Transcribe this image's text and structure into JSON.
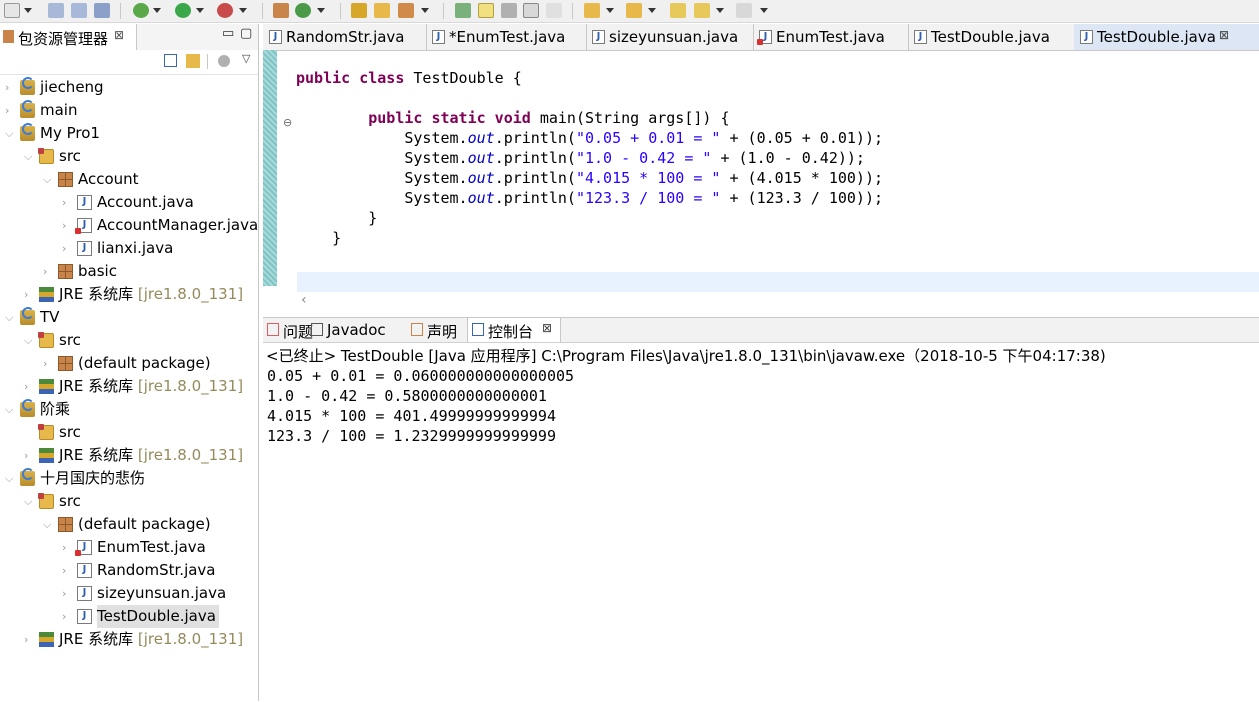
{
  "package_explorer": {
    "tab_title": "包资源管理器",
    "tree": [
      {
        "label": "jiecheng",
        "type": "project",
        "depth": 0,
        "expanded": false
      },
      {
        "label": "main",
        "type": "project",
        "depth": 0,
        "expanded": false
      },
      {
        "label": "My Pro1",
        "type": "project",
        "depth": 0,
        "expanded": true
      },
      {
        "label": "src",
        "type": "src",
        "depth": 1,
        "expanded": true
      },
      {
        "label": "Account",
        "type": "package",
        "depth": 2,
        "expanded": true
      },
      {
        "label": "Account.java",
        "type": "java",
        "depth": 3,
        "expanded": false
      },
      {
        "label": "AccountManager.java",
        "type": "java-err",
        "depth": 3,
        "expanded": false
      },
      {
        "label": "lianxi.java",
        "type": "java",
        "depth": 3,
        "expanded": false
      },
      {
        "label": "basic",
        "type": "package",
        "depth": 2,
        "expanded": false
      },
      {
        "label": "JRE 系统库",
        "suffix": "[jre1.8.0_131]",
        "type": "jre",
        "depth": 1,
        "expanded": false
      },
      {
        "label": "TV",
        "type": "project",
        "depth": 0,
        "expanded": true
      },
      {
        "label": "src",
        "type": "src",
        "depth": 1,
        "expanded": true
      },
      {
        "label": "(default package)",
        "type": "package",
        "depth": 2,
        "expanded": false
      },
      {
        "label": "JRE 系统库",
        "suffix": "[jre1.8.0_131]",
        "type": "jre",
        "depth": 1,
        "expanded": false
      },
      {
        "label": "阶乘",
        "type": "project",
        "depth": 0,
        "expanded": true
      },
      {
        "label": "src",
        "type": "src",
        "depth": 1,
        "expanded": false,
        "noTwistie": true
      },
      {
        "label": "JRE 系统库",
        "suffix": "[jre1.8.0_131]",
        "type": "jre",
        "depth": 1,
        "expanded": false
      },
      {
        "label": "十月国庆的悲伤",
        "type": "project",
        "depth": 0,
        "expanded": true
      },
      {
        "label": "src",
        "type": "src",
        "depth": 1,
        "expanded": true
      },
      {
        "label": "(default package)",
        "type": "package",
        "depth": 2,
        "expanded": true
      },
      {
        "label": "EnumTest.java",
        "type": "java-err",
        "depth": 3,
        "expanded": false
      },
      {
        "label": "RandomStr.java",
        "type": "java",
        "depth": 3,
        "expanded": false
      },
      {
        "label": "sizeyunsuan.java",
        "type": "java",
        "depth": 3,
        "expanded": false
      },
      {
        "label": "TestDouble.java",
        "type": "java",
        "depth": 3,
        "expanded": false,
        "selected": true
      },
      {
        "label": "JRE 系统库",
        "suffix": "[jre1.8.0_131]",
        "type": "jre",
        "depth": 1,
        "expanded": false
      }
    ]
  },
  "editor": {
    "tabs": [
      {
        "label": "RandomStr.java",
        "error": false,
        "active": false
      },
      {
        "label": "*EnumTest.java",
        "error": false,
        "active": false
      },
      {
        "label": "sizeyunsuan.java",
        "error": false,
        "active": false
      },
      {
        "label": "EnumTest.java",
        "error": true,
        "active": false
      },
      {
        "label": "TestDouble.java",
        "error": false,
        "active": false
      },
      {
        "label": "TestDouble.java",
        "error": false,
        "active": true
      }
    ],
    "code": {
      "class_kw": "public class",
      "class_name": " TestDouble {",
      "method_kw": "public static void",
      "method_sig": " main(String args[]) {",
      "lines": [
        {
          "pre": "System.",
          "fld": "out",
          "mid": ".println(",
          "str": "\"0.05 + 0.01 = \"",
          "post": " + (0.05 + 0.01));"
        },
        {
          "pre": "System.",
          "fld": "out",
          "mid": ".println(",
          "str": "\"1.0 - 0.42 = \"",
          "post": " + (1.0 - 0.42));"
        },
        {
          "pre": "System.",
          "fld": "out",
          "mid": ".println(",
          "str": "\"4.015 * 100 = \"",
          "post": " + (4.015 * 100));"
        },
        {
          "pre": "System.",
          "fld": "out",
          "mid": ".println(",
          "str": "\"123.3 / 100 = \"",
          "post": " + (123.3 / 100));"
        }
      ],
      "close_method": "}",
      "close_class": "}"
    }
  },
  "bottom_panel": {
    "tabs": [
      {
        "label": "问题",
        "active": false
      },
      {
        "label": "Javadoc",
        "active": false
      },
      {
        "label": "声明",
        "active": false
      },
      {
        "label": "控制台",
        "active": true
      }
    ],
    "console_header": "<已终止> TestDouble [Java 应用程序] C:\\Program Files\\Java\\jre1.8.0_131\\bin\\javaw.exe（2018-10-5 下午04:17:38)",
    "output": [
      "0.05 + 0.01 = 0.060000000000000005",
      "1.0 - 0.42 = 0.5800000000000001",
      "4.015 * 100 = 401.49999999999994",
      "123.3 / 100 = 1.2329999999999999"
    ]
  },
  "colors": {
    "keyword": "#7f0055",
    "string": "#2a00ff",
    "field": "#0000c0",
    "muted": "#958a5c"
  }
}
